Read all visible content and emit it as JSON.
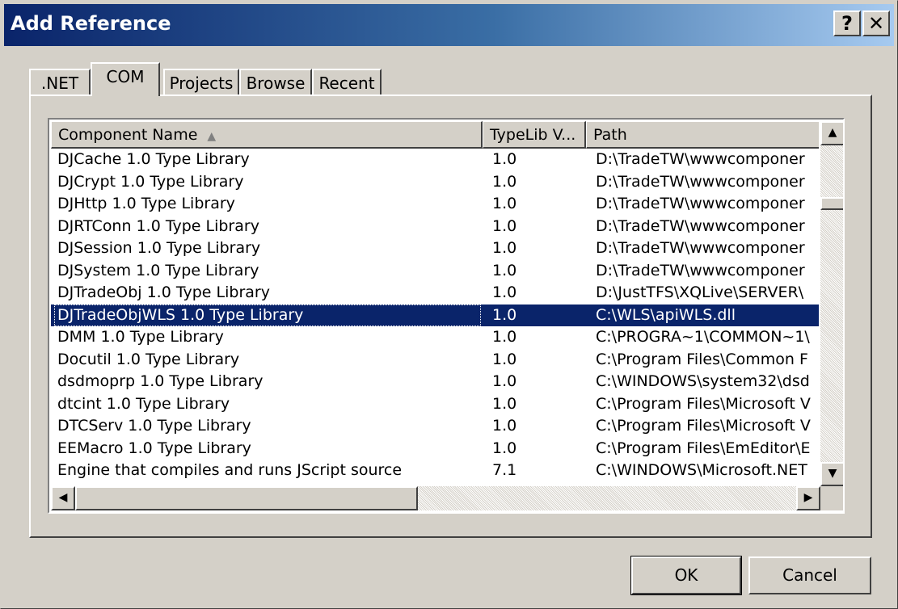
{
  "window": {
    "title": "Add Reference",
    "help_label": "?",
    "close_label": "✕"
  },
  "tabs": [
    {
      "label": ".NET"
    },
    {
      "label": "COM"
    },
    {
      "label": "Projects"
    },
    {
      "label": "Browse"
    },
    {
      "label": "Recent"
    }
  ],
  "active_tab": "COM",
  "table": {
    "columns": [
      "Component Name",
      "TypeLib V...",
      "Path"
    ],
    "sort_column": "Component Name",
    "rows": [
      {
        "name": "DJCache 1.0 Type Library",
        "version": "1.0",
        "path": "D:\\TradeTW\\wwwcomponer"
      },
      {
        "name": "DJCrypt 1.0 Type Library",
        "version": "1.0",
        "path": "D:\\TradeTW\\wwwcomponer"
      },
      {
        "name": "DJHttp 1.0 Type Library",
        "version": "1.0",
        "path": "D:\\TradeTW\\wwwcomponer"
      },
      {
        "name": "DJRTConn 1.0 Type Library",
        "version": "1.0",
        "path": "D:\\TradeTW\\wwwcomponer"
      },
      {
        "name": "DJSession 1.0 Type Library",
        "version": "1.0",
        "path": "D:\\TradeTW\\wwwcomponer"
      },
      {
        "name": "DJSystem 1.0 Type Library",
        "version": "1.0",
        "path": "D:\\TradeTW\\wwwcomponer"
      },
      {
        "name": "DJTradeObj 1.0 Type Library",
        "version": "1.0",
        "path": "D:\\JustTFS\\XQLive\\SERVER\\"
      },
      {
        "name": "DJTradeObjWLS 1.0 Type Library",
        "version": "1.0",
        "path": "C:\\WLS\\apiWLS.dll"
      },
      {
        "name": "DMM 1.0 Type Library",
        "version": "1.0",
        "path": "C:\\PROGRA~1\\COMMON~1\\"
      },
      {
        "name": "Docutil 1.0 Type Library",
        "version": "1.0",
        "path": "C:\\Program Files\\Common F"
      },
      {
        "name": "dsdmoprp 1.0 Type Library",
        "version": "1.0",
        "path": "C:\\WINDOWS\\system32\\dsd"
      },
      {
        "name": "dtcint 1.0 Type Library",
        "version": "1.0",
        "path": "C:\\Program Files\\Microsoft V"
      },
      {
        "name": "DTCServ 1.0 Type Library",
        "version": "1.0",
        "path": "C:\\Program Files\\Microsoft V"
      },
      {
        "name": "EEMacro 1.0 Type Library",
        "version": "1.0",
        "path": "C:\\Program Files\\EmEditor\\E"
      },
      {
        "name": "Engine that compiles and runs JScript source",
        "version": "7.1",
        "path": "C:\\WINDOWS\\Microsoft.NET"
      }
    ],
    "selected_row": "DJTradeObjWLS 1.0 Type Library"
  },
  "buttons": {
    "ok": "OK",
    "cancel": "Cancel"
  },
  "icons": {
    "sort": "sort-ascending-icon",
    "scroll_up": "arrow-up-icon",
    "scroll_down": "arrow-down-icon",
    "scroll_left": "arrow-left-icon",
    "scroll_right": "arrow-right-icon"
  },
  "colors": {
    "title_start": "#0a246a",
    "title_end": "#a6caf0",
    "selection": "#0a246a",
    "face": "#d4d0c8"
  }
}
